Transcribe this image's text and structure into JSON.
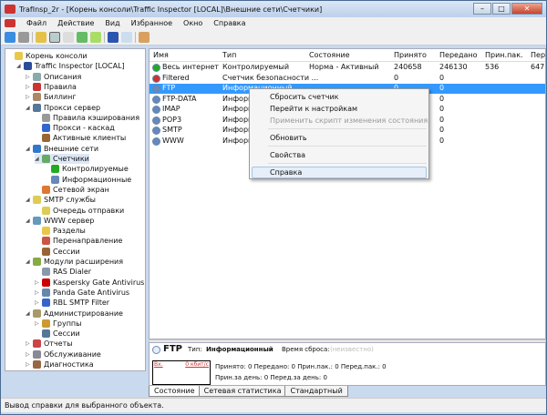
{
  "window": {
    "title": "TrafInsp_2r - [Корень консоли\\Traffic Inspector [LOCAL]\\Внешние сети\\Счетчики]",
    "minimize": "–",
    "maximize": "□",
    "close": "✕"
  },
  "menu": [
    "Файл",
    "Действие",
    "Вид",
    "Избранное",
    "Окно",
    "Справка"
  ],
  "tree": [
    {
      "label": "Корень консоли",
      "level": 0,
      "toggle": "",
      "color": "#e8c84a"
    },
    {
      "label": "Traffic Inspector [LOCAL]",
      "level": 1,
      "toggle": "◢",
      "color": "#2a4d9a"
    },
    {
      "label": "Описания",
      "level": 2,
      "toggle": "▷",
      "color": "#8aa"
    },
    {
      "label": "Правила",
      "level": 2,
      "toggle": "▷",
      "color": "#c33"
    },
    {
      "label": "Биллинг",
      "level": 2,
      "toggle": "▷",
      "color": "#a86"
    },
    {
      "label": "Прокси сервер",
      "level": 2,
      "toggle": "◢",
      "color": "#579"
    },
    {
      "label": "Правила кэширования",
      "level": 3,
      "toggle": "",
      "color": "#999"
    },
    {
      "label": "Прокси - каскад",
      "level": 3,
      "toggle": "",
      "color": "#36c"
    },
    {
      "label": "Активные клиенты",
      "level": 3,
      "toggle": "",
      "color": "#963"
    },
    {
      "label": "Внешние сети",
      "level": 2,
      "toggle": "◢",
      "color": "#37c"
    },
    {
      "label": "Счетчики",
      "level": 3,
      "toggle": "◢",
      "color": "#6a6"
    },
    {
      "label": "Контролируемые",
      "level": 4,
      "toggle": "",
      "color": "#2a2"
    },
    {
      "label": "Информационные",
      "level": 4,
      "toggle": "",
      "color": "#68b"
    },
    {
      "label": "Сетевой экран",
      "level": 3,
      "toggle": "",
      "color": "#d73"
    },
    {
      "label": "SMTP службы",
      "level": 2,
      "toggle": "◢",
      "color": "#dc5"
    },
    {
      "label": "Очередь отправки",
      "level": 3,
      "toggle": "",
      "color": "#dc5"
    },
    {
      "label": "WWW сервер",
      "level": 2,
      "toggle": "◢",
      "color": "#69b"
    },
    {
      "label": "Разделы",
      "level": 3,
      "toggle": "",
      "color": "#e8c84a"
    },
    {
      "label": "Перенаправление",
      "level": 3,
      "toggle": "",
      "color": "#c54"
    },
    {
      "label": "Сессии",
      "level": 3,
      "toggle": "",
      "color": "#963"
    },
    {
      "label": "Модули расширения",
      "level": 2,
      "toggle": "◢",
      "color": "#8a4"
    },
    {
      "label": "RAS Dialer",
      "level": 3,
      "toggle": "",
      "color": "#89a"
    },
    {
      "label": "Kaspersky Gate Antivirus",
      "level": 3,
      "toggle": "▷",
      "color": "#c00"
    },
    {
      "label": "Panda Gate Antivirus",
      "level": 3,
      "toggle": "▷",
      "color": "#68a"
    },
    {
      "label": "RBL SMTP Filter",
      "level": 3,
      "toggle": "▷",
      "color": "#36c"
    },
    {
      "label": "Администрирование",
      "level": 2,
      "toggle": "◢",
      "color": "#a96"
    },
    {
      "label": "Группы",
      "level": 3,
      "toggle": "▷",
      "color": "#c93"
    },
    {
      "label": "Сессии",
      "level": 3,
      "toggle": "",
      "color": "#579"
    },
    {
      "label": "Отчеты",
      "level": 2,
      "toggle": "▷",
      "color": "#c44"
    },
    {
      "label": "Обслуживание",
      "level": 2,
      "toggle": "▷",
      "color": "#889"
    },
    {
      "label": "Диагностика",
      "level": 2,
      "toggle": "▷",
      "color": "#964"
    }
  ],
  "list": {
    "columns": [
      "Имя",
      "Тип",
      "Состояние",
      "Принято",
      "Передано",
      "Прин.пак.",
      "Пер"
    ],
    "rows": [
      {
        "name": "Весь интернет",
        "type": "Контролируемый",
        "state": "Норма - Активный",
        "rx": "240658",
        "tx": "246130",
        "rxp": "536",
        "txp": "647",
        "icon": "#2a2"
      },
      {
        "name": "Filtered",
        "type": "Счетчик безопасности ...",
        "state": "",
        "rx": "0",
        "tx": "0",
        "rxp": "",
        "txp": "",
        "icon": "#c33"
      },
      {
        "name": "FTP",
        "type": "Информационный",
        "state": "",
        "rx": "0",
        "tx": "0",
        "rxp": "",
        "txp": "",
        "icon": "#68b",
        "selected": true
      },
      {
        "name": "FTP-DATA",
        "type": "Информационный",
        "state": "",
        "rx": "0",
        "tx": "0",
        "rxp": "",
        "txp": "",
        "icon": "#68b"
      },
      {
        "name": "IMAP",
        "type": "Информационный",
        "state": "",
        "rx": "0",
        "tx": "0",
        "rxp": "",
        "txp": "",
        "icon": "#68b"
      },
      {
        "name": "POP3",
        "type": "Информационный",
        "state": "",
        "rx": "0",
        "tx": "0",
        "rxp": "",
        "txp": "",
        "icon": "#68b"
      },
      {
        "name": "SMTP",
        "type": "Информационный",
        "state": "",
        "rx": "0",
        "tx": "0",
        "rxp": "",
        "txp": "",
        "icon": "#68b"
      },
      {
        "name": "WWW",
        "type": "Информационный",
        "state": "",
        "rx": "0",
        "tx": "0",
        "rxp": "",
        "txp": "",
        "icon": "#68b"
      }
    ]
  },
  "context_menu": {
    "reset": "Сбросить счетчик",
    "goto_settings": "Перейти к настройкам",
    "apply_script": "Применить скрипт изменения состояния",
    "refresh": "Обновить",
    "properties": "Свойства",
    "help": "Справка"
  },
  "details": {
    "name": "FTP",
    "type_label": "Тип:",
    "type_value": "Информационный",
    "reset_label": "Время сброса:",
    "reset_value": "(неизвестно)",
    "graph_in": "Вх.",
    "graph_rate": "0 кбит/с",
    "stats": "Принято: 0   Передано: 0   Прин.пак.: 0   Перед.пак.: 0",
    "stats2": "Прин.за день: 0   Перед.за день: 0"
  },
  "tabs": [
    "Состояние",
    "Сетевая статистика",
    "Стандартный"
  ],
  "status": "Вывод справки для выбранного объекта."
}
